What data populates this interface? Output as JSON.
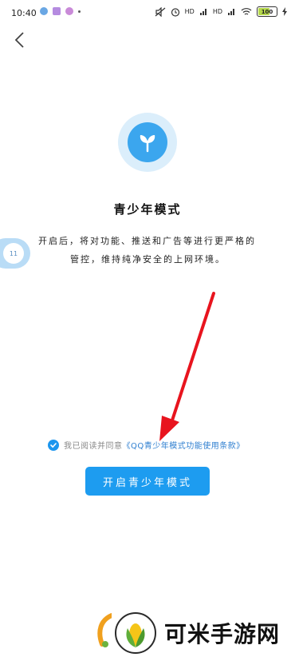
{
  "status_bar": {
    "time": "10:40",
    "signal1_label": "HD",
    "signal2_label": "HD",
    "battery_percent": "100"
  },
  "page": {
    "title": "青少年模式",
    "description_line1": "开启后，将对功能、推送和广告等进行更严格的",
    "description_line2": "管控，维持纯净安全的上网环境。"
  },
  "agreement": {
    "checked": true,
    "prefix": "我已阅读并同意",
    "link": "《QQ青少年模式功能使用条款》"
  },
  "enable_button": {
    "label": "开启青少年模式"
  },
  "float_assist": {
    "label": "11"
  },
  "watermark": {
    "text": "可米手游网"
  },
  "colors": {
    "accent": "#1d9cf0",
    "logo_bg": "#dbeefb",
    "link": "#2f7fd0",
    "arrow": "#e8141e"
  }
}
